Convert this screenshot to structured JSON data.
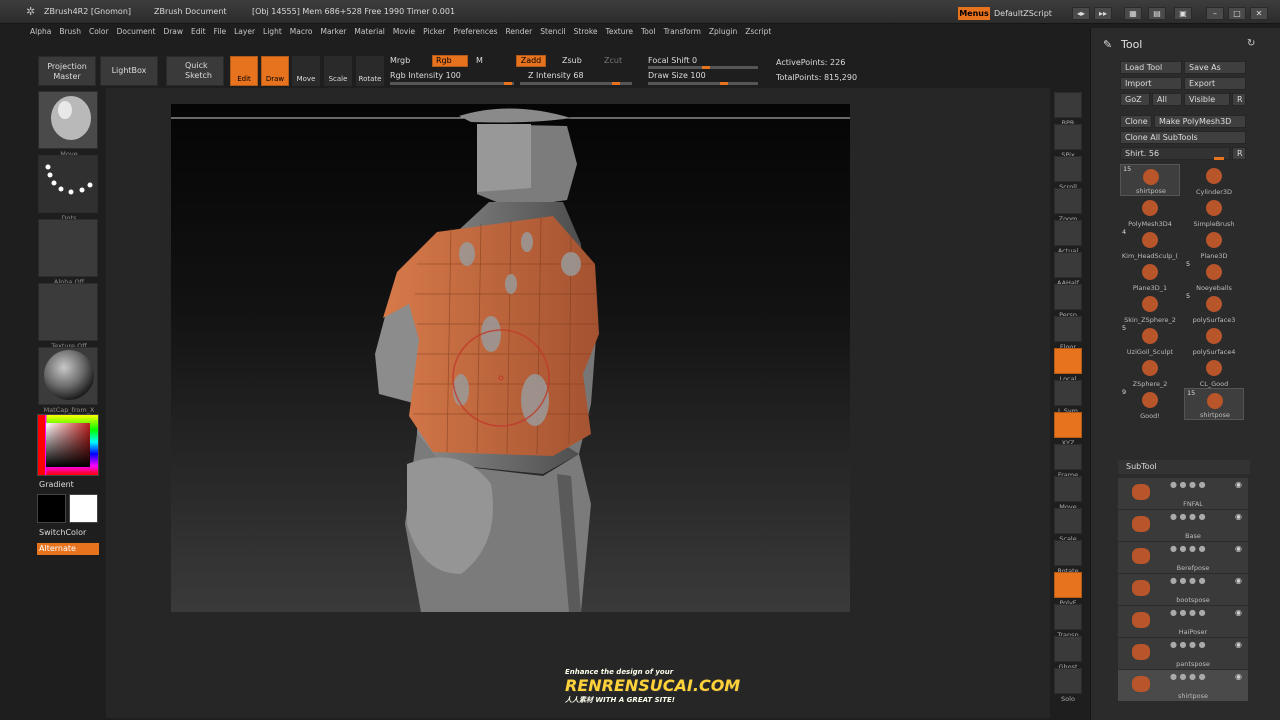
{
  "titlebar": {
    "app": "ZBrush4R2 [Gnomon]",
    "document": "ZBrush Document",
    "stats": "[Obj 14555] Mem 686+528 Free 1990 Timer 0.001",
    "menus": "Menus",
    "script": "DefaultZScript"
  },
  "menubar": [
    "Alpha",
    "Brush",
    "Color",
    "Document",
    "Draw",
    "Edit",
    "File",
    "Layer",
    "Light",
    "Macro",
    "Marker",
    "Material",
    "Movie",
    "Picker",
    "Preferences",
    "Render",
    "Stencil",
    "Stroke",
    "Texture",
    "Tool",
    "Transform",
    "Zplugin",
    "Zscript"
  ],
  "shelf": {
    "projection_master": "Projection Master",
    "lightbox": "LightBox",
    "quick_sketch": "Quick Sketch",
    "edit": "Edit",
    "draw": "Draw",
    "move": "Move",
    "scale": "Scale",
    "rotate": "Rotate",
    "mrgb": "Mrgb",
    "rgb": "Rgb",
    "m": "M",
    "rgb_intensity": "Rgb Intensity 100",
    "zadd": "Zadd",
    "zsub": "Zsub",
    "zcut": "Zcut",
    "z_intensity": "Z Intensity 68",
    "focal_shift": "Focal Shift 0",
    "draw_size": "Draw Size 100",
    "active_points": "ActivePoints: 226",
    "total_points": "TotalPoints: 815,290"
  },
  "leftpanel": {
    "brush": "Move",
    "stroke": "Dots",
    "alpha": "Alpha Off",
    "texture": "Texture Off",
    "material": "MatCap_from_X",
    "gradient": "Gradient",
    "switchcolor": "SwitchColor",
    "alternate": "Alternate"
  },
  "rightshelf": [
    "BPR",
    "SPix",
    "Scroll",
    "Zoom",
    "Actual",
    "AAHalf",
    "Persp",
    "Floor",
    "Local",
    "L.Sym",
    "XYZ",
    "Frame",
    "Move",
    "Scale",
    "Rotate",
    "PolyF",
    "Transp",
    "Ghost",
    "Solo"
  ],
  "toolpanel": {
    "title": "Tool",
    "load_tool": "Load Tool",
    "save_as": "Save As",
    "import": "Import",
    "export": "Export",
    "goz": "GoZ",
    "all": "All",
    "visible": "Visible",
    "r": "R",
    "clone": "Clone",
    "make_polymesh": "Make PolyMesh3D",
    "clone_all": "Clone All SubTools",
    "shirt_slider": "Shirt. 56",
    "tools": [
      {
        "name": "shirtpose",
        "count": "15"
      },
      {
        "name": "Cylinder3D",
        "count": ""
      },
      {
        "name": "PolyMesh3D4",
        "count": ""
      },
      {
        "name": "SimpleBrush",
        "count": ""
      },
      {
        "name": "Kim_HeadSculp_(",
        "count": "4"
      },
      {
        "name": "Plane3D",
        "count": ""
      },
      {
        "name": "Plane3D_1",
        "count": ""
      },
      {
        "name": "Noeyeballs",
        "count": "5"
      },
      {
        "name": "Skin_ZSphere_2",
        "count": ""
      },
      {
        "name": "polySurface3",
        "count": "5"
      },
      {
        "name": "UziGoil_Sculpt",
        "count": "5"
      },
      {
        "name": "polySurface4",
        "count": ""
      },
      {
        "name": "ZSphere_2",
        "count": ""
      },
      {
        "name": "CL_Good",
        "count": ""
      },
      {
        "name": "Good!",
        "count": "9"
      },
      {
        "name": "shirtpose",
        "count": "15"
      }
    ],
    "subtool_title": "SubTool",
    "subtools": [
      "FNFAL",
      "Base",
      "Berefpose",
      "bootspose",
      "HaiPoser",
      "pantspose",
      "shirtpose"
    ]
  },
  "watermark": {
    "line1": "Enhance the design of your",
    "brand": "RENRENSUCAI.COM",
    "line2": "人人素材 WITH A GREAT SITE!"
  }
}
